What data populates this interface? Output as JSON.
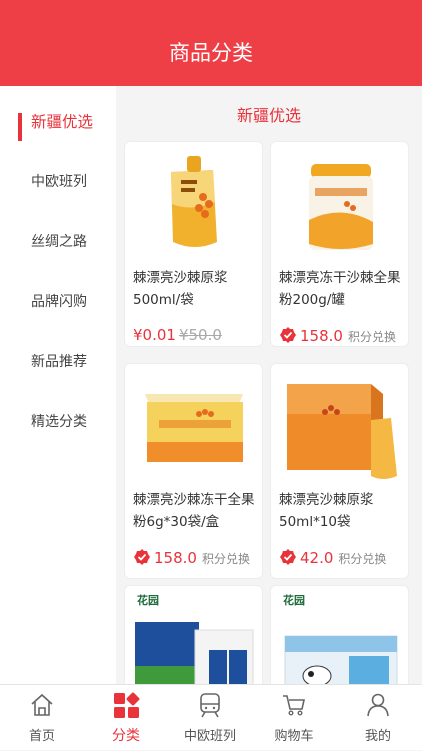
{
  "header": {
    "title": "商品分类"
  },
  "sidebar": {
    "items": [
      {
        "label": "新疆优选"
      },
      {
        "label": "中欧班列"
      },
      {
        "label": "丝绸之路"
      },
      {
        "label": "品牌闪购"
      },
      {
        "label": "新品推荐"
      },
      {
        "label": "精选分类"
      }
    ]
  },
  "main": {
    "section_title": "新疆优选",
    "products": [
      {
        "name": "棘漂亮沙棘原浆500ml/袋",
        "price": "¥0.01",
        "old_price": "¥50.0"
      },
      {
        "name": "棘漂亮冻干沙棘全果粉200g/罐",
        "price": "158.0",
        "points_label": "积分兑换"
      },
      {
        "name": "棘漂亮沙棘冻干全果粉6g*30袋/盒",
        "price": "158.0",
        "points_label": "积分兑换"
      },
      {
        "name": "棘漂亮沙棘原浆50ml*10袋",
        "price": "42.0",
        "points_label": "积分兑换"
      },
      {
        "brand": "花园"
      },
      {
        "brand": "花园"
      }
    ]
  },
  "tabbar": {
    "items": [
      {
        "label": "首页"
      },
      {
        "label": "分类"
      },
      {
        "label": "中欧班列"
      },
      {
        "label": "购物车"
      },
      {
        "label": "我的"
      }
    ]
  },
  "colors": {
    "accent": "#ef3f46",
    "active": "#e8333b"
  },
  "icons": [
    "home-icon",
    "category-icon",
    "train-icon",
    "cart-icon",
    "user-icon",
    "points-badge-icon"
  ]
}
